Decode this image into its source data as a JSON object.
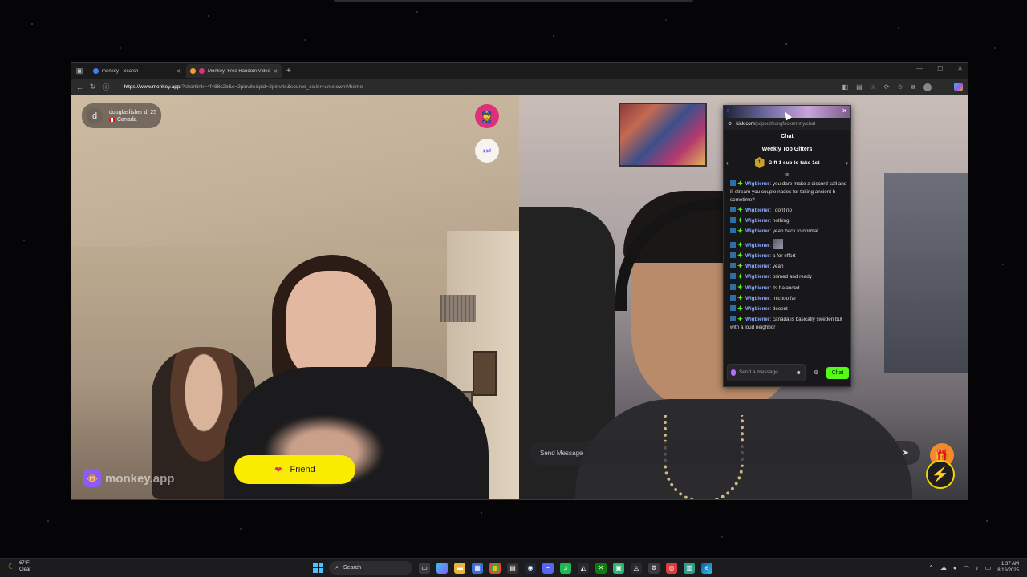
{
  "browser": {
    "tabs": [
      {
        "title": "monkey - Search",
        "active": false
      },
      {
        "title": "Monkey: Free Random Video",
        "active": true
      }
    ],
    "url_host": "https://www.monkey.app",
    "url_rest": "/?shortlink=4f488c2b&c=2pinvite&pid=2pinvite&source_caller=unknown#/home"
  },
  "left_video": {
    "user_initial": "d",
    "user_name": "douglasfisher d, 25",
    "country": "Canada",
    "friend_label": "Friend",
    "brand": "monkey.app"
  },
  "right_video": {
    "send_placeholder": "Send Message"
  },
  "chat_popout": {
    "url_host": "kick.com",
    "url_path": "/popout/kungfookennny/chat",
    "header": "Chat",
    "gifters_title": "Weekly Top Gifters",
    "gift_rank": "1",
    "gift_text": "Gift 1 sub to take 1st",
    "messages": [
      {
        "user": "Wigbiener",
        "text": ": you dare make a discord call and ill stream you couple nades for taking ancient b sometime?"
      },
      {
        "user": "Wigbiener",
        "text": ": i dont no"
      },
      {
        "user": "Wigbiener",
        "text": ": nothing"
      },
      {
        "user": "Wigbiener",
        "text": ": yeah back to normal"
      },
      {
        "user": "Wigbiener",
        "text": ":"
      },
      {
        "user": "Wigbiener",
        "text": ": a for effort"
      },
      {
        "user": "Wigbiener",
        "text": ": yeah"
      },
      {
        "user": "Wigbiener",
        "text": ": primed and ready"
      },
      {
        "user": "Wigbiener",
        "text": ": its balanced"
      },
      {
        "user": "Wigbiener",
        "text": ": mic too far"
      },
      {
        "user": "Wigbiener",
        "text": ": decent"
      },
      {
        "user": "Wigbiener",
        "text": ": canada is basically sweden but with a loud neighbor"
      }
    ],
    "input_placeholder": "Send a message",
    "send_label": "Chat"
  },
  "taskbar": {
    "temperature": "67°F",
    "weather": "Clear",
    "search_label": "Search",
    "time": "1:37 AM",
    "date": "8/16/2025"
  }
}
